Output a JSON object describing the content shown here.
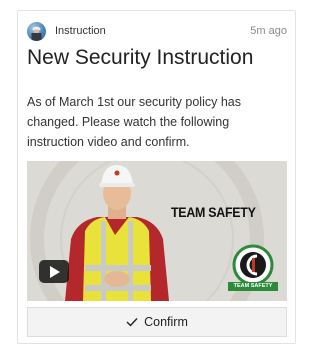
{
  "card": {
    "type_label": "Instruction",
    "time_ago": "5m ago",
    "title": "New Security Instruction",
    "body": "As of March 1st our security policy has changed. Please watch the following instruction video and confirm."
  },
  "video": {
    "overlay_text": "TEAM SAFETY",
    "badge_text": "TEAM SAFETY",
    "play_icon": "play-icon"
  },
  "actions": {
    "confirm_label": "Confirm",
    "confirm_icon": "check-icon"
  },
  "colors": {
    "badge_green": "#2c8a3a",
    "vest_yellow": "#e8e23a",
    "shirt_red": "#b4282c"
  }
}
